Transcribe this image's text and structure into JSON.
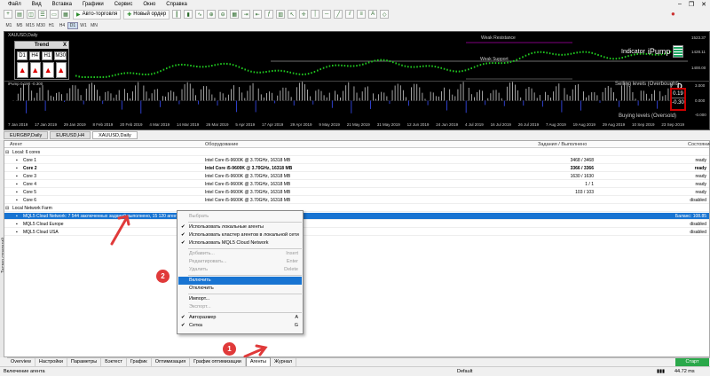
{
  "menu": [
    "Файл",
    "Вид",
    "Вставка",
    "Графики",
    "Сервис",
    "Окно",
    "Справка"
  ],
  "toolbar": {
    "algo_label": "Авто-торговля",
    "new_order_label": "Новый ордер"
  },
  "timeframes": [
    "M1",
    "M5",
    "M15",
    "M30",
    "H1",
    "H4",
    "D1",
    "W1",
    "MN"
  ],
  "chart": {
    "title": "XAUUSD,Daily",
    "trend_title": "Trend",
    "trend_close": "X",
    "trend_tfs": [
      "D1",
      "H4",
      "H1",
      "M30"
    ],
    "arrow": "🡅",
    "indicator_name": "Indicator",
    "indicator_brand": "iPump",
    "weak_support": "Weak Support",
    "weak_resistance": "Weak Resistance",
    "ipump_sub": "iPump 0.190 -0.300",
    "selling_levels": "Selling levels (Overbought)",
    "buying_levels": "Buying levels (Oversold)",
    "d_letter": "D",
    "d_val_up": "0.19",
    "d_val_down": "-0.30",
    "price_labels": [
      "1523.37",
      "1428.11",
      "1400.00"
    ],
    "sub_labels": [
      "3.000",
      "0.000",
      "-0.000"
    ],
    "dates": [
      "7 Jan 2019",
      "17 Jan 2019",
      "29 Jan 2019",
      "8 Feb 2019",
      "20 Feb 2019",
      "4 Mar 2019",
      "14 Mar 2019",
      "26 Mar 2019",
      "5 Apr 2019",
      "17 Apr 2019",
      "29 Apr 2019",
      "9 May 2019",
      "21 May 2019",
      "31 May 2019",
      "12 Jun 2019",
      "24 Jun 2019",
      "4 Jul 2019",
      "16 Jul 2019",
      "26 Jul 2019",
      "7 Aug 2019",
      "19 Aug 2019",
      "29 Aug 2019",
      "10 Sep 2019",
      "23 Sep 2019"
    ]
  },
  "symbol_tabs": [
    "EURGBP,Daily",
    "EURUSD,H4",
    "XAUUSD,Daily"
  ],
  "side_label": "Тестер стратегий",
  "table": {
    "headers": {
      "agent": "Агент",
      "hw": "Оборудование",
      "tasks": "Задания / Выполнено",
      "state": "Состояние"
    },
    "rows": [
      {
        "agent": "Local: 6 cores",
        "hw": "",
        "tasks": "",
        "state": "",
        "type": "group"
      },
      {
        "agent": "Core 1",
        "hw": "Intel Core i5-9600K  @ 3.70GHz, 16318 MB",
        "tasks": "3468 / 3468",
        "state": "ready",
        "type": "core"
      },
      {
        "agent": "Core 2",
        "hw": "Intel Core i5-9600K  @ 3.70GHz, 16318 MB",
        "tasks": "3366 / 3366",
        "state": "ready",
        "type": "core bold"
      },
      {
        "agent": "Core 3",
        "hw": "Intel Core i5-9600K  @ 3.70GHz, 16318 MB",
        "tasks": "1630 / 1630",
        "state": "ready",
        "type": "core"
      },
      {
        "agent": "Core 4",
        "hw": "Intel Core i5-9600K  @ 3.70GHz, 16318 MB",
        "tasks": "1 / 1",
        "state": "ready",
        "type": "core"
      },
      {
        "agent": "Core 5",
        "hw": "Intel Core i5-9600K  @ 3.70GHz, 16318 MB",
        "tasks": "103 / 103",
        "state": "ready",
        "type": "core"
      },
      {
        "agent": "Core 6",
        "hw": "Intel Core i5-9600K  @ 3.70GHz, 16318 MB",
        "tasks": "",
        "state": "disabled",
        "type": "core"
      },
      {
        "agent": "Local Network Farm",
        "hw": "",
        "tasks": "",
        "state": "",
        "type": "group"
      },
      {
        "agent": "MQL5 Cloud Network: 7 544 заключенных заданий выполнено, 15 120 агентов доступно",
        "hw": "",
        "tasks": "",
        "state": "Баланс: 108.85",
        "type": "sel"
      },
      {
        "agent": "MQL5 Cloud Europe",
        "hw": "",
        "tasks": "",
        "state": "disabled",
        "type": "cloud"
      },
      {
        "agent": "MQL5 Cloud USA",
        "hw": "",
        "tasks": "",
        "state": "disabled",
        "type": "cloud"
      }
    ]
  },
  "context_menu": [
    {
      "label": "Выбрать",
      "shortcut": "",
      "state": "dis",
      "check": ""
    },
    {
      "label": "Использовать локальные агенты",
      "shortcut": "",
      "state": "",
      "check": "✔"
    },
    {
      "label": "Использовать кластер агентов в локальной сети",
      "shortcut": "",
      "state": "",
      "check": "✔"
    },
    {
      "label": "Использовать MQL5 Cloud Network",
      "shortcut": "",
      "state": "",
      "check": "✔"
    },
    {
      "label": "Добавить...",
      "shortcut": "Insert",
      "state": "dis",
      "check": ""
    },
    {
      "label": "Редактировать...",
      "shortcut": "Enter",
      "state": "dis",
      "check": ""
    },
    {
      "label": "Удалить",
      "shortcut": "Delete",
      "state": "dis",
      "check": ""
    },
    {
      "label": "Включить",
      "shortcut": "",
      "state": "hl",
      "check": ""
    },
    {
      "label": "Отключить",
      "shortcut": "",
      "state": "",
      "check": ""
    },
    {
      "label": "Импорт...",
      "shortcut": "",
      "state": "",
      "check": ""
    },
    {
      "label": "Экспорт...",
      "shortcut": "",
      "state": "dis",
      "check": ""
    },
    {
      "label": "Авторазмер",
      "shortcut": "A",
      "state": "",
      "check": "✔"
    },
    {
      "label": "Сетка",
      "shortcut": "G",
      "state": "",
      "check": "✔"
    }
  ],
  "badges": {
    "one": "1",
    "two": "2"
  },
  "bottom_tabs": [
    "Overview",
    "Настройки",
    "Параметры",
    "Бэктест",
    "График",
    "Оптимизация",
    "График оптимизации",
    "Агенты",
    "Журнал"
  ],
  "start_label": "Старт",
  "status": {
    "left": "Включение агента",
    "profile": "Default",
    "size": "44.72 ms"
  },
  "colors": {
    "accent": "#1874d2",
    "badge": "#e03a3a",
    "start": "#2aa84a"
  }
}
